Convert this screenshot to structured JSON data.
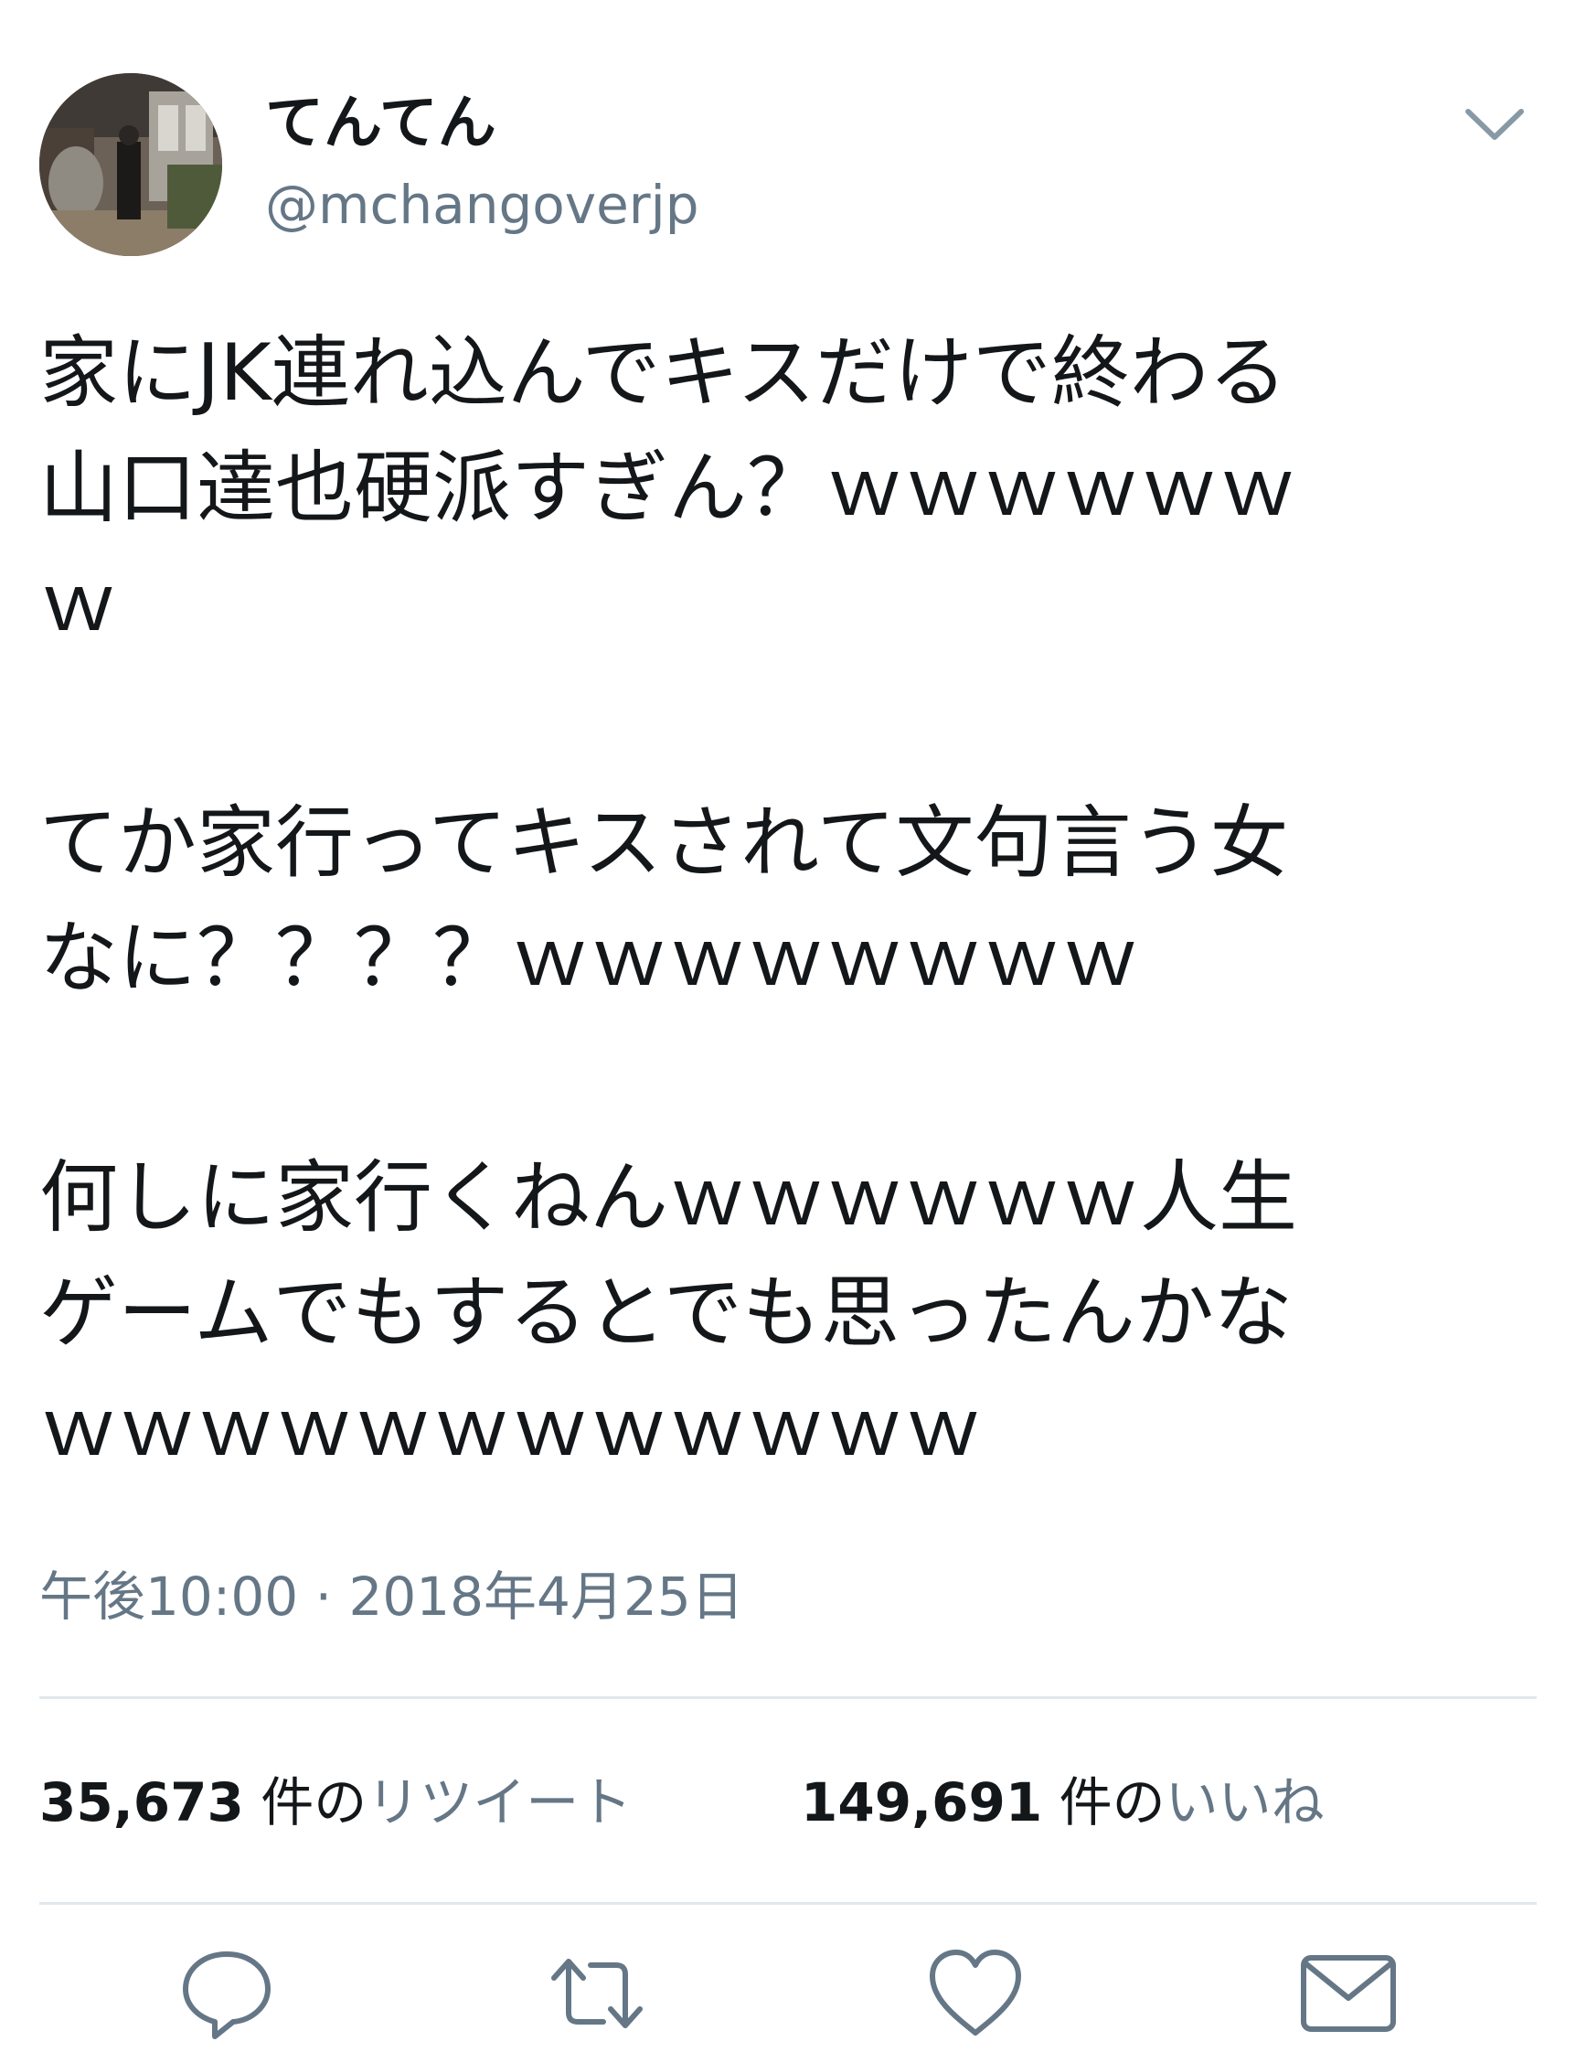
{
  "user": {
    "display_name": "てんてん",
    "handle": "@mchangoverjp"
  },
  "tweet": {
    "lines": [
      "家にJK連れ込んでキスだけで終わる",
      "山口達也硬派すぎん？ｗｗｗｗｗｗ",
      "ｗ",
      "",
      "てか家行ってキスされて文句言う女",
      "なに？？？？ｗｗｗｗｗｗｗｗ",
      "",
      "何しに家行くねんｗｗｗｗｗｗ人生",
      "ゲームでもするとでも思ったんかな",
      "ｗｗｗｗｗｗｗｗｗｗｗｗ"
    ],
    "timestamp": "午後10:00 · 2018年4月25日"
  },
  "stats": {
    "retweets_count": "35,673",
    "retweets_unit": "件の",
    "retweets_label": "リツイート",
    "likes_count": "149,691",
    "likes_unit": "件の",
    "likes_label": "いいね"
  },
  "actions": {
    "reply_icon": "reply-icon",
    "retweet_icon": "retweet-icon",
    "like_icon": "heart-icon",
    "share_icon": "envelope-icon"
  },
  "colors": {
    "text": "#14171a",
    "secondary": "#657786",
    "divider": "#e1e8ed"
  }
}
